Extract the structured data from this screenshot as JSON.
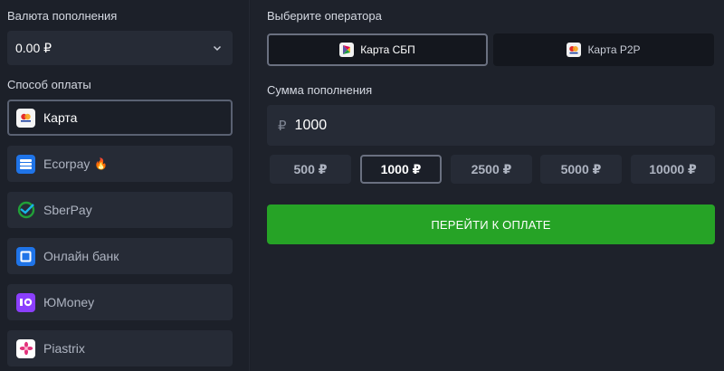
{
  "left": {
    "currency_label": "Валюта пополнения",
    "currency_value": "0.00 ₽",
    "method_label": "Способ оплаты",
    "methods": [
      {
        "label": "Карта",
        "icon": "bank-card-icon"
      },
      {
        "label": "Ecorpay",
        "icon": "ecorpay-icon",
        "emoji": "🔥"
      },
      {
        "label": "SberPay",
        "icon": "sberpay-icon"
      },
      {
        "label": "Онлайн банк",
        "icon": "online-bank-icon"
      },
      {
        "label": "ЮMoney",
        "icon": "yoomoney-icon"
      },
      {
        "label": "Piastrix",
        "icon": "piastrix-icon"
      }
    ]
  },
  "right": {
    "operator_label": "Выберите оператора",
    "operators": [
      {
        "label": "Карта СБП",
        "icon": "sbp-icon"
      },
      {
        "label": "Карта P2P",
        "icon": "mastercard-icon"
      }
    ],
    "amount_label": "Сумма пополнения",
    "amount_currency": "₽",
    "amount_value": "1000",
    "presets": [
      "500 ₽",
      "1000 ₽",
      "2500 ₽",
      "5000 ₽",
      "10000 ₽"
    ],
    "pay_button": "ПЕРЕЙТИ К ОПЛАТЕ"
  },
  "colors": {
    "background": "#1c2029",
    "panel": "#262b36",
    "accent_green": "#26a326"
  }
}
